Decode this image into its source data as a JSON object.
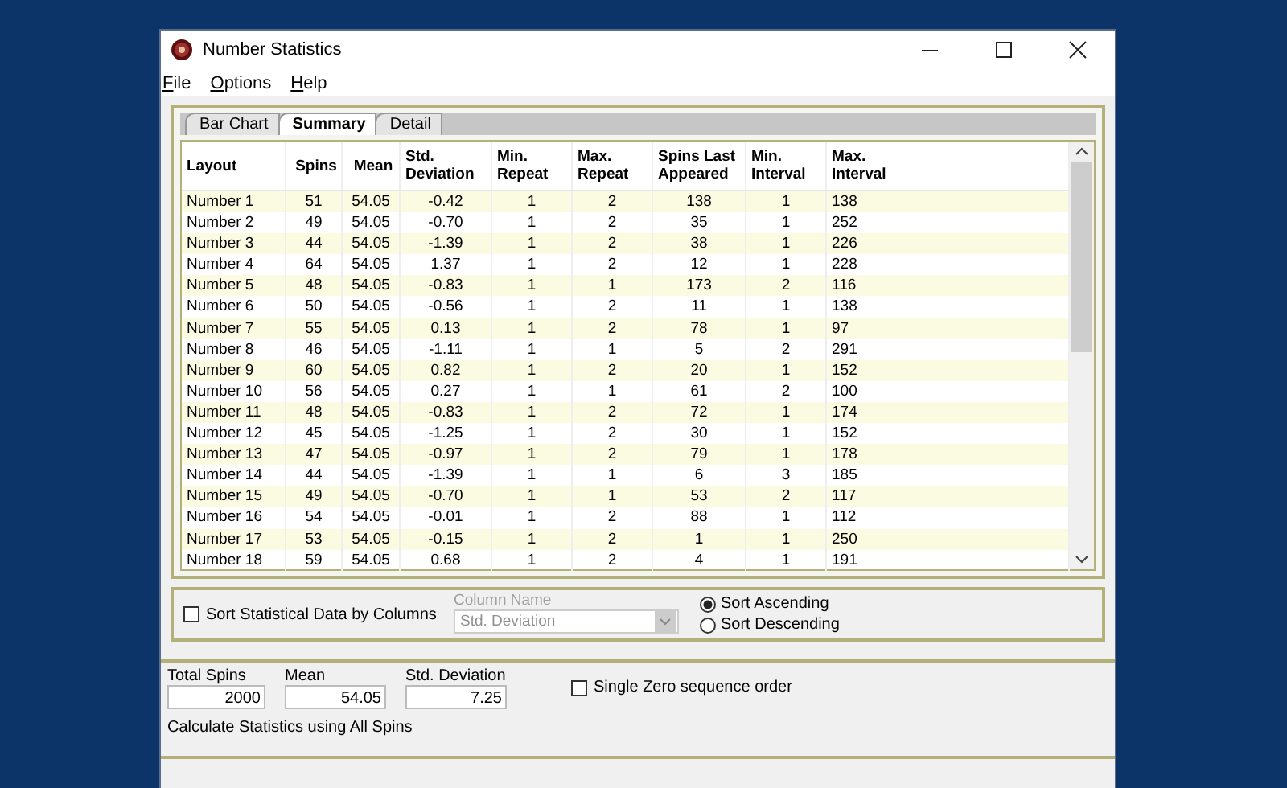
{
  "window": {
    "title": "Number Statistics"
  },
  "menu": [
    "File",
    "Options",
    "Help"
  ],
  "tabs": [
    {
      "label": "Bar Chart",
      "selected": false
    },
    {
      "label": "Summary",
      "selected": true
    },
    {
      "label": "Detail",
      "selected": false
    }
  ],
  "table": {
    "columns": [
      "Layout",
      "Spins",
      "Mean",
      "Std.\nDeviation",
      "Min.\nRepeat",
      "Max.\nRepeat",
      "Spins Last\nAppeared",
      "Min.\nInterval",
      "Max.\nInterval"
    ],
    "rows": [
      [
        "Number 1",
        "51",
        "54.05",
        "-0.42",
        "1",
        "2",
        "138",
        "1",
        "138"
      ],
      [
        "Number 2",
        "49",
        "54.05",
        "-0.70",
        "1",
        "2",
        "35",
        "1",
        "252"
      ],
      [
        "Number 3",
        "44",
        "54.05",
        "-1.39",
        "1",
        "2",
        "38",
        "1",
        "226"
      ],
      [
        "Number 4",
        "64",
        "54.05",
        "1.37",
        "1",
        "2",
        "12",
        "1",
        "228"
      ],
      [
        "Number 5",
        "48",
        "54.05",
        "-0.83",
        "1",
        "1",
        "173",
        "2",
        "116"
      ],
      [
        "Number 6",
        "50",
        "54.05",
        "-0.56",
        "1",
        "2",
        "11",
        "1",
        "138"
      ],
      [
        "Number 7",
        "55",
        "54.05",
        "0.13",
        "1",
        "2",
        "78",
        "1",
        "97"
      ],
      [
        "Number 8",
        "46",
        "54.05",
        "-1.11",
        "1",
        "1",
        "5",
        "2",
        "291"
      ],
      [
        "Number 9",
        "60",
        "54.05",
        "0.82",
        "1",
        "2",
        "20",
        "1",
        "152"
      ],
      [
        "Number 10",
        "56",
        "54.05",
        "0.27",
        "1",
        "1",
        "61",
        "2",
        "100"
      ],
      [
        "Number 11",
        "48",
        "54.05",
        "-0.83",
        "1",
        "2",
        "72",
        "1",
        "174"
      ],
      [
        "Number 12",
        "45",
        "54.05",
        "-1.25",
        "1",
        "2",
        "30",
        "1",
        "152"
      ],
      [
        "Number 13",
        "47",
        "54.05",
        "-0.97",
        "1",
        "2",
        "79",
        "1",
        "178"
      ],
      [
        "Number 14",
        "44",
        "54.05",
        "-1.39",
        "1",
        "1",
        "6",
        "3",
        "185"
      ],
      [
        "Number 15",
        "49",
        "54.05",
        "-0.70",
        "1",
        "1",
        "53",
        "2",
        "117"
      ],
      [
        "Number 16",
        "54",
        "54.05",
        "-0.01",
        "1",
        "2",
        "88",
        "1",
        "112"
      ],
      [
        "Number 17",
        "53",
        "54.05",
        "-0.15",
        "1",
        "2",
        "1",
        "1",
        "250"
      ],
      [
        "Number 18",
        "59",
        "54.05",
        "0.68",
        "1",
        "2",
        "4",
        "1",
        "191"
      ]
    ]
  },
  "sort": {
    "checkbox": {
      "label": "Sort Statistical Data by Columns",
      "checked": false
    },
    "column_name": {
      "label": "Column Name",
      "value": "Std. Deviation",
      "disabled": true
    },
    "options": [
      {
        "label": "Sort Ascending",
        "selected": true
      },
      {
        "label": "Sort Descending",
        "selected": false
      }
    ]
  },
  "totals": {
    "fields": [
      {
        "label": "Total Spins",
        "value": "2000"
      },
      {
        "label": "Mean",
        "value": "54.05"
      },
      {
        "label": "Std. Deviation",
        "value": "7.25"
      }
    ],
    "single_zero": {
      "label": "Single Zero sequence order",
      "checked": false
    },
    "note": "Calculate Statistics using All Spins"
  }
}
